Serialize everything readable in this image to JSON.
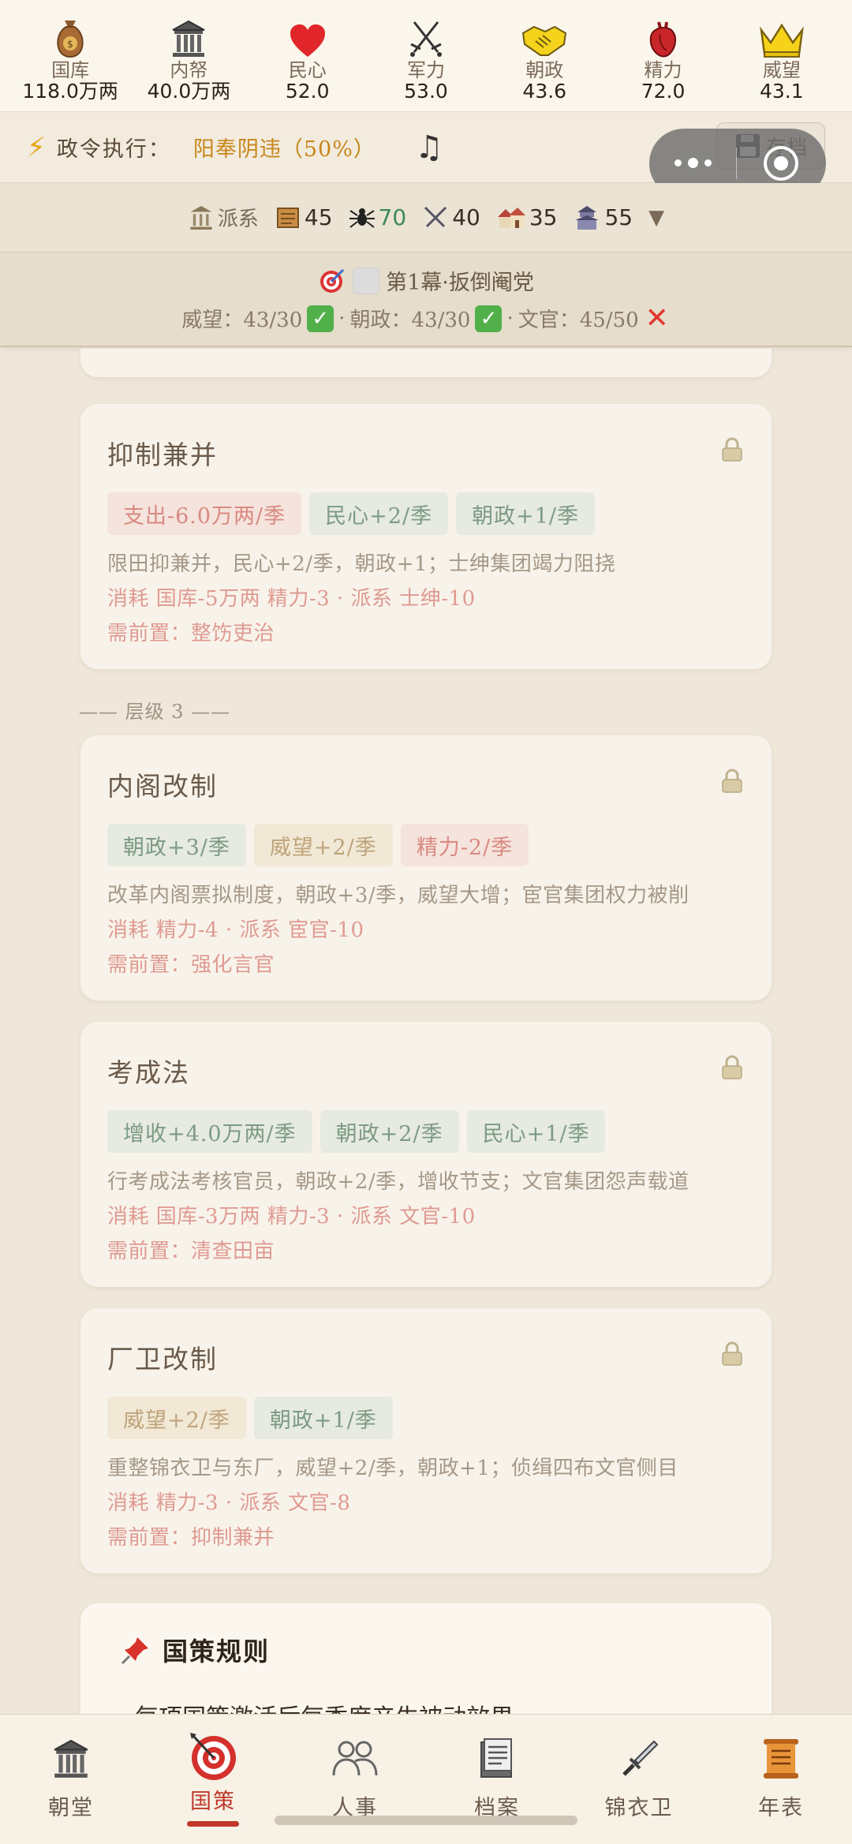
{
  "stats": [
    {
      "icon": "money-bag-icon",
      "label": "国库",
      "value": "118.0万两"
    },
    {
      "icon": "palace-icon",
      "label": "内帑",
      "value": "40.0万两"
    },
    {
      "icon": "heart-icon",
      "label": "民心",
      "value": "52.0"
    },
    {
      "icon": "crossed-swords-icon",
      "label": "军力",
      "value": "53.0"
    },
    {
      "icon": "handshake-icon",
      "label": "朝政",
      "value": "43.6"
    },
    {
      "icon": "anatomical-heart-icon",
      "label": "精力",
      "value": "72.0"
    },
    {
      "icon": "crown-icon",
      "label": "威望",
      "value": "43.1"
    }
  ],
  "decree": {
    "label": "政令执行：",
    "value": "阳奉阴违（50%）"
  },
  "save_button": "存档",
  "factions": {
    "label": "派系",
    "items": [
      {
        "icon": "scroll-icon",
        "value": "45",
        "highlight": false
      },
      {
        "icon": "spider-icon",
        "value": "70",
        "highlight": true
      },
      {
        "icon": "swords-icon",
        "value": "40",
        "highlight": false
      },
      {
        "icon": "houses-icon",
        "value": "35",
        "highlight": false
      },
      {
        "icon": "castle-icon",
        "value": "55",
        "highlight": false
      }
    ]
  },
  "objective": {
    "title": "第1幕·扳倒阉党",
    "conditions": [
      {
        "text": "威望：43/30",
        "met": true
      },
      {
        "text": "朝政：43/30",
        "met": true
      },
      {
        "text": "文官：45/50",
        "met": false
      }
    ],
    "separator": "·"
  },
  "tier_label": "—— 层级 3 ——",
  "policies": [
    {
      "title": "抑制兼并",
      "tags": [
        {
          "text": "支出-6.0万两/季",
          "kind": "bad"
        },
        {
          "text": "民心+2/季",
          "kind": "good"
        },
        {
          "text": "朝政+1/季",
          "kind": "good"
        }
      ],
      "desc": "限田抑兼并，民心+2/季，朝政+1；士绅集团竭力阻挠",
      "cost": "消耗 国库-5万两 精力-3 · 派系 士绅-10",
      "prereq": "需前置：整饬吏治"
    },
    {
      "title": "内阁改制",
      "tags": [
        {
          "text": "朝政+3/季",
          "kind": "good"
        },
        {
          "text": "威望+2/季",
          "kind": "neutral"
        },
        {
          "text": "精力-2/季",
          "kind": "bad"
        }
      ],
      "desc": "改革内阁票拟制度，朝政+3/季，威望大增；宦官集团权力被削",
      "cost": "消耗 精力-4 · 派系 宦官-10",
      "prereq": "需前置：强化言官"
    },
    {
      "title": "考成法",
      "tags": [
        {
          "text": "增收+4.0万两/季",
          "kind": "good"
        },
        {
          "text": "朝政+2/季",
          "kind": "good"
        },
        {
          "text": "民心+1/季",
          "kind": "good"
        }
      ],
      "desc": "行考成法考核官员，朝政+2/季，增收节支；文官集团怨声载道",
      "cost": "消耗 国库-3万两 精力-3 · 派系 文官-10",
      "prereq": "需前置：清查田亩"
    },
    {
      "title": "厂卫改制",
      "tags": [
        {
          "text": "威望+2/季",
          "kind": "neutral"
        },
        {
          "text": "朝政+1/季",
          "kind": "good"
        }
      ],
      "desc": "重整锦衣卫与东厂，威望+2/季，朝政+1；侦缉四布文官侧目",
      "cost": "消耗 精力-3 · 派系 文官-8",
      "prereq": "需前置：抑制兼并"
    }
  ],
  "rules": {
    "title": "国策规则",
    "first_line": "· 每项国策激活后每季度产生被动效果"
  },
  "nav": [
    {
      "icon": "palace-icon",
      "label": "朝堂",
      "active": false
    },
    {
      "icon": "dart-target-icon",
      "label": "国策",
      "active": true
    },
    {
      "icon": "people-icon",
      "label": "人事",
      "active": false
    },
    {
      "icon": "archive-icon",
      "label": "档案",
      "active": false
    },
    {
      "icon": "dagger-icon",
      "label": "锦衣卫",
      "active": false
    },
    {
      "icon": "scroll-chart-icon",
      "label": "年表",
      "active": false
    }
  ],
  "colors": {
    "accent_red": "#c0392b",
    "decree_value": "#c8861a",
    "faction_highlight": "#3d8a5a",
    "tag_good_text": "#7c9a84",
    "tag_bad_text": "#d98a80",
    "tag_neutral_text": "#bfa47a"
  }
}
